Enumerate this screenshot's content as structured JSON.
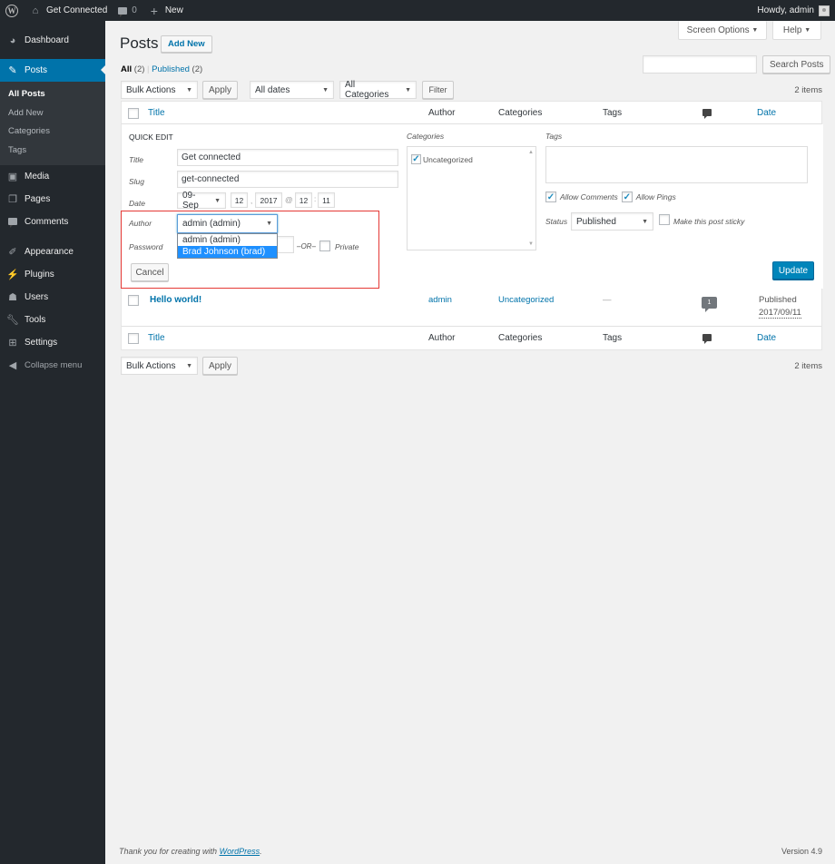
{
  "adminbar": {
    "site_name": "Get Connected",
    "comments_count": "0",
    "new_label": "New",
    "greeting": "Howdy, admin"
  },
  "sidebar": {
    "items": [
      {
        "label": "Dashboard",
        "icon": "dashboard-icon"
      },
      {
        "label": "Posts",
        "icon": "pin-icon",
        "current": true
      },
      {
        "label": "Media",
        "icon": "media-icon"
      },
      {
        "label": "Pages",
        "icon": "pages-icon"
      },
      {
        "label": "Comments",
        "icon": "comment-icon"
      },
      {
        "label": "Appearance",
        "icon": "paintbrush-icon"
      },
      {
        "label": "Plugins",
        "icon": "plugin-icon"
      },
      {
        "label": "Users",
        "icon": "user-icon"
      },
      {
        "label": "Tools",
        "icon": "wrench-icon"
      },
      {
        "label": "Settings",
        "icon": "settings-icon"
      }
    ],
    "submenu": [
      "All Posts",
      "Add New",
      "Categories",
      "Tags"
    ],
    "collapse": "Collapse menu"
  },
  "header": {
    "title": "Posts",
    "add_new": "Add New",
    "screen_options": "Screen Options",
    "help": "Help"
  },
  "views": {
    "all": "All",
    "all_count": "(2)",
    "sep": "|",
    "published": "Published",
    "published_count": "(2)"
  },
  "search": {
    "value": "",
    "button": "Search Posts"
  },
  "toolbar": {
    "bulk_actions": "Bulk Actions",
    "apply": "Apply",
    "dates": "All dates",
    "categories": "All Categories",
    "filter": "Filter",
    "items_count": "2 items"
  },
  "columns": {
    "title": "Title",
    "author": "Author",
    "categories": "Categories",
    "tags": "Tags",
    "date": "Date"
  },
  "quick_edit": {
    "heading": "QUICK EDIT",
    "title_label": "Title",
    "title_value": "Get connected",
    "slug_label": "Slug",
    "slug_value": "get-connected",
    "date_label": "Date",
    "month": "09-Sep",
    "day": "12",
    "year": "2017",
    "at": "@",
    "hour": "12",
    "minute": "11",
    "author_label": "Author",
    "author_value": "admin (admin)",
    "author_options": [
      "admin (admin)",
      "Brad Johnson (brad)"
    ],
    "password_label": "Password",
    "or": "–OR–",
    "private": "Private",
    "cancel": "Cancel",
    "categories_label": "Categories",
    "category_items": [
      {
        "label": "Uncategorized",
        "checked": true
      }
    ],
    "tags_label": "Tags",
    "tags_value": "",
    "allow_comments": "Allow Comments",
    "allow_pings": "Allow Pings",
    "status_label": "Status",
    "status_value": "Published",
    "sticky": "Make this post sticky",
    "update": "Update"
  },
  "rows": [
    {
      "title": "Hello world!",
      "author": "admin",
      "categories": "Uncategorized",
      "tags": "—",
      "comments": "1",
      "date_status": "Published",
      "date": "2017/09/11"
    }
  ],
  "footer": {
    "thanks": "Thank you for creating with",
    "wp_link": "WordPress",
    "period": ".",
    "version": "Version 4.9"
  }
}
